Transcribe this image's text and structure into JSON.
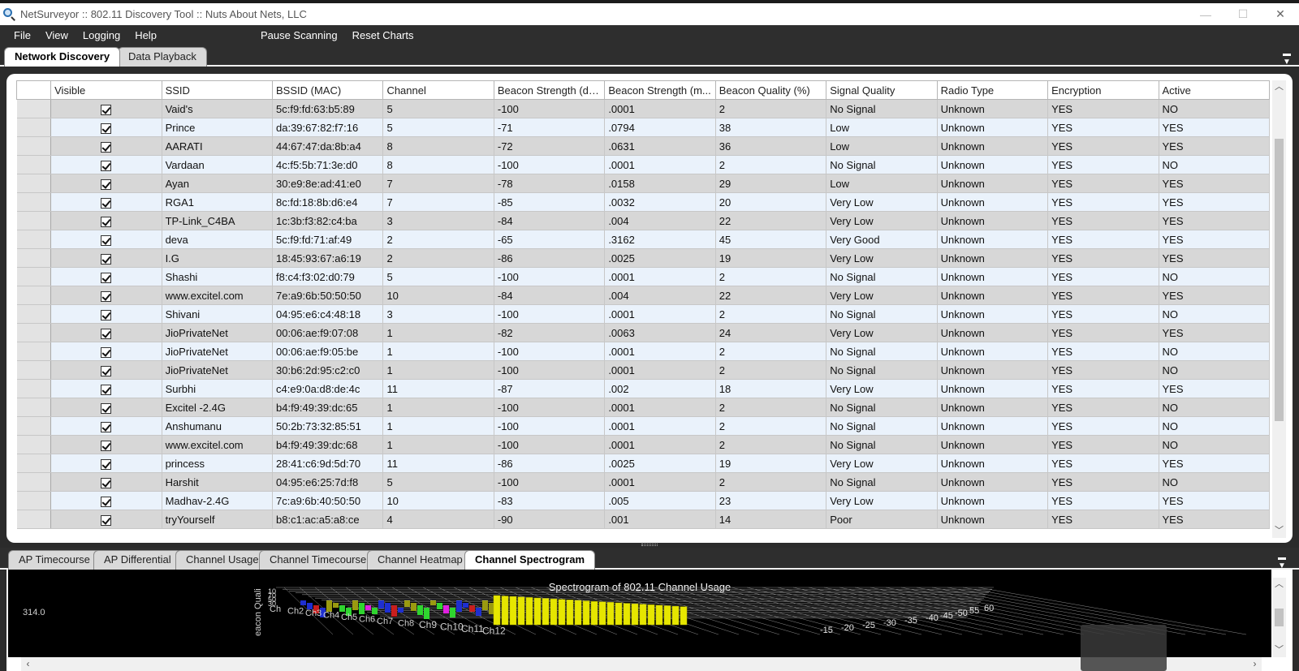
{
  "window": {
    "title": "NetSurveyor :: 802.11 Discovery Tool :: Nuts About Nets, LLC",
    "controls": {
      "minimize": "—",
      "maximize": "☐",
      "close": "✕"
    }
  },
  "menubar": {
    "items": [
      "File",
      "View",
      "Logging",
      "Help"
    ],
    "actions": [
      "Pause Scanning",
      "Reset Charts"
    ]
  },
  "main_tabs": [
    {
      "label": "Network Discovery",
      "active": true
    },
    {
      "label": "Data Playback",
      "active": false
    }
  ],
  "grid": {
    "columns": [
      "Visible",
      "SSID",
      "BSSID (MAC)",
      "Channel",
      "Beacon Strength (dB...",
      "Beacon Strength (m...",
      "Beacon Quality (%)",
      "Signal Quality",
      "Radio Type",
      "Encryption",
      "Active"
    ],
    "rows": [
      [
        "Vaid's",
        "5c:f9:fd:63:b5:89",
        "5",
        "-100",
        ".0001",
        "2",
        "No Signal",
        "Unknown",
        "YES",
        "NO"
      ],
      [
        "Prince",
        "da:39:67:82:f7:16",
        "5",
        "-71",
        ".0794",
        "38",
        "Low",
        "Unknown",
        "YES",
        "YES"
      ],
      [
        "AARATI",
        "44:67:47:da:8b:a4",
        "8",
        "-72",
        ".0631",
        "36",
        "Low",
        "Unknown",
        "YES",
        "YES"
      ],
      [
        "Vardaan",
        "4c:f5:5b:71:3e:d0",
        "8",
        "-100",
        ".0001",
        "2",
        "No Signal",
        "Unknown",
        "YES",
        "NO"
      ],
      [
        "Ayan",
        "30:e9:8e:ad:41:e0",
        "7",
        "-78",
        ".0158",
        "29",
        "Low",
        "Unknown",
        "YES",
        "YES"
      ],
      [
        "RGA1",
        "8c:fd:18:8b:d6:e4",
        "7",
        "-85",
        ".0032",
        "20",
        "Very Low",
        "Unknown",
        "YES",
        "YES"
      ],
      [
        "TP-Link_C4BA",
        "1c:3b:f3:82:c4:ba",
        "3",
        "-84",
        ".004",
        "22",
        "Very Low",
        "Unknown",
        "YES",
        "YES"
      ],
      [
        "deva",
        "5c:f9:fd:71:af:49",
        "2",
        "-65",
        ".3162",
        "45",
        "Very Good",
        "Unknown",
        "YES",
        "YES"
      ],
      [
        "I.G",
        "18:45:93:67:a6:19",
        "2",
        "-86",
        ".0025",
        "19",
        "Very Low",
        "Unknown",
        "YES",
        "YES"
      ],
      [
        "Shashi",
        "f8:c4:f3:02:d0:79",
        "5",
        "-100",
        ".0001",
        "2",
        "No Signal",
        "Unknown",
        "YES",
        "NO"
      ],
      [
        "www.excitel.com",
        "7e:a9:6b:50:50:50",
        "10",
        "-84",
        ".004",
        "22",
        "Very Low",
        "Unknown",
        "YES",
        "YES"
      ],
      [
        "Shivani",
        "04:95:e6:c4:48:18",
        "3",
        "-100",
        ".0001",
        "2",
        "No Signal",
        "Unknown",
        "YES",
        "NO"
      ],
      [
        "JioPrivateNet",
        "00:06:ae:f9:07:08",
        "1",
        "-82",
        ".0063",
        "24",
        "Very Low",
        "Unknown",
        "YES",
        "YES"
      ],
      [
        "JioPrivateNet",
        "00:06:ae:f9:05:be",
        "1",
        "-100",
        ".0001",
        "2",
        "No Signal",
        "Unknown",
        "YES",
        "NO"
      ],
      [
        "JioPrivateNet",
        "30:b6:2d:95:c2:c0",
        "1",
        "-100",
        ".0001",
        "2",
        "No Signal",
        "Unknown",
        "YES",
        "NO"
      ],
      [
        "Surbhi",
        "c4:e9:0a:d8:de:4c",
        "11",
        "-87",
        ".002",
        "18",
        "Very Low",
        "Unknown",
        "YES",
        "YES"
      ],
      [
        "Excitel -2.4G",
        "b4:f9:49:39:dc:65",
        "1",
        "-100",
        ".0001",
        "2",
        "No Signal",
        "Unknown",
        "YES",
        "NO"
      ],
      [
        "Anshumanu",
        "50:2b:73:32:85:51",
        "1",
        "-100",
        ".0001",
        "2",
        "No Signal",
        "Unknown",
        "YES",
        "NO"
      ],
      [
        "www.excitel.com",
        "b4:f9:49:39:dc:68",
        "1",
        "-100",
        ".0001",
        "2",
        "No Signal",
        "Unknown",
        "YES",
        "NO"
      ],
      [
        "princess",
        "28:41:c6:9d:5d:70",
        "11",
        "-86",
        ".0025",
        "19",
        "Very Low",
        "Unknown",
        "YES",
        "YES"
      ],
      [
        "Harshit",
        "04:95:e6:25:7d:f8",
        "5",
        "-100",
        ".0001",
        "2",
        "No Signal",
        "Unknown",
        "YES",
        "NO"
      ],
      [
        "Madhav-2.4G",
        "7c:a9:6b:40:50:50",
        "10",
        "-83",
        ".005",
        "23",
        "Very Low",
        "Unknown",
        "YES",
        "YES"
      ],
      [
        "tryYourself",
        "b8:c1:ac:a5:a8:ce",
        "4",
        "-90",
        ".001",
        "14",
        "Poor",
        "Unknown",
        "YES",
        "YES"
      ]
    ]
  },
  "chart_tabs": [
    {
      "label": "AP Timecourse",
      "active": false
    },
    {
      "label": "AP Differential",
      "active": false
    },
    {
      "label": "Channel Usage",
      "active": false
    },
    {
      "label": "Channel Timecourse",
      "active": false
    },
    {
      "label": "Channel Heatmap",
      "active": false
    },
    {
      "label": "Channel Spectrogram",
      "active": true
    }
  ],
  "chart": {
    "title": "Spectrogram of 802.11 Channel Usage",
    "side_value": "314.0",
    "axis_label_fragment": "eacon Quali",
    "ytick_fragments": [
      "10",
      "70",
      "50",
      "30"
    ],
    "channel_labels": [
      "Ch",
      "Ch2",
      "Ch3",
      "Ch4",
      "Ch5",
      "Ch6",
      "Ch7",
      "Ch8",
      "Ch9",
      "Ch10",
      "Ch11",
      "Ch12"
    ],
    "depth_labels": [
      "-15",
      "-20",
      "-25",
      "-30",
      "-35",
      "-40",
      "-45",
      "-50",
      "55",
      "60"
    ],
    "colors": {
      "background": "#000000",
      "grid": "#8c8c8c",
      "bars_main": "#e6e600",
      "bars_green": "#2fd52f",
      "bars_blue": "#1e2fd0",
      "bars_red": "#c81e1e",
      "bars_olive": "#9a9a10",
      "bars_magenta": "#e020e0"
    }
  },
  "icons": {
    "app": "magnifier-icon",
    "panel_menu": "panel-menu-icon",
    "scroll_up": "scroll-up-arrow-icon",
    "scroll_down": "scroll-down-arrow-icon",
    "scroll_left": "scroll-left-arrow-icon",
    "scroll_right": "scroll-right-arrow-icon",
    "checkbox": "checkbox-checked-icon"
  }
}
